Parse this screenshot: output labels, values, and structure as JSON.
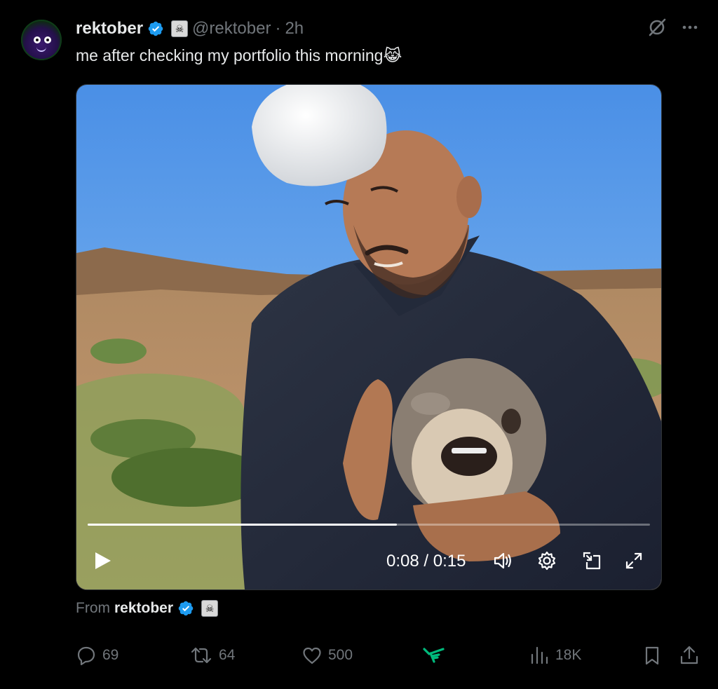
{
  "tweet": {
    "author_name": "rektober",
    "handle": "@rektober",
    "separator": "·",
    "time": "2h",
    "text": "me after checking my portfolio this morning😹"
  },
  "video": {
    "progress": 0.55,
    "time_display": "0:08 / 0:15"
  },
  "attribution": {
    "from_label": "From",
    "from_name": "rektober"
  },
  "actions": {
    "replies": "69",
    "reposts": "64",
    "likes": "500",
    "views": "18K"
  },
  "colors": {
    "verified": "#1d9bf0",
    "text_secondary": "#71767b",
    "grok_green": "#00ba7c"
  }
}
